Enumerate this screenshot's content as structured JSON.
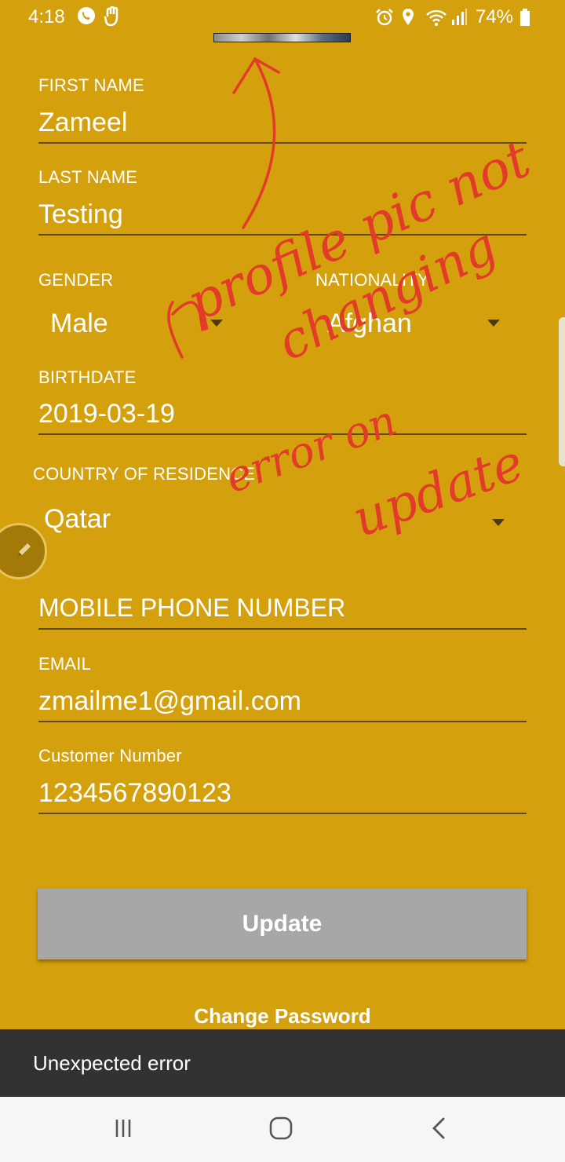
{
  "status_bar": {
    "time": "4:18",
    "battery": "74%",
    "icons": [
      "whatsapp-icon",
      "hand-icon",
      "alarm-icon",
      "location-icon",
      "wifi-icon",
      "signal-icon",
      "battery-icon"
    ]
  },
  "form": {
    "first_name": {
      "label": "FIRST NAME",
      "value": "Zameel"
    },
    "last_name": {
      "label": "LAST NAME",
      "value": "Testing"
    },
    "gender": {
      "label": "GENDER",
      "value": "Male"
    },
    "nationality": {
      "label": "NATIONALITY",
      "value": "Afghan"
    },
    "birthdate": {
      "label": "BIRTHDATE",
      "value": "2019-03-19"
    },
    "country": {
      "label": "COUNTRY OF RESIDENCE",
      "value": "Qatar"
    },
    "mobile": {
      "placeholder": "MOBILE PHONE NUMBER"
    },
    "email": {
      "label": "EMAIL",
      "value": "zmailme1@gmail.com"
    },
    "customer_number": {
      "label": "Customer Number",
      "value": "1234567890123"
    }
  },
  "actions": {
    "update_label": "Update",
    "change_password_label": "Change Password"
  },
  "snackbar": {
    "message": "Unexpected error"
  },
  "annotation": {
    "lines": [
      "profile pic not",
      "changing",
      "error on",
      "update"
    ],
    "color": "#E33B2A"
  },
  "colors": {
    "background": "#D4A00E",
    "button": "#A7A7A7",
    "snackbar": "#323232",
    "navbar": "#F6F6F6"
  }
}
